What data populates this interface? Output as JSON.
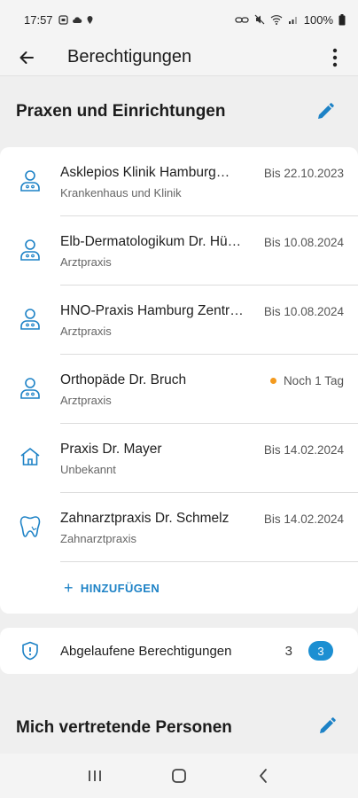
{
  "status_bar": {
    "time": "17:57",
    "battery": "100%"
  },
  "app_bar": {
    "title": "Berechtigungen"
  },
  "section_practices": {
    "title": "Praxen und Einrichtungen",
    "items": [
      {
        "name": "Asklepios Klinik Hamburg…",
        "type": "Krankenhaus und Klinik",
        "meta": "Bis 22.10.2023",
        "icon": "doctor-icon",
        "warning": false
      },
      {
        "name": "Elb-Dermatologikum Dr. Hü…",
        "type": "Arztpraxis",
        "meta": "Bis 10.08.2024",
        "icon": "doctor-icon",
        "warning": false
      },
      {
        "name": "HNO-Praxis Hamburg Zentr…",
        "type": "Arztpraxis",
        "meta": "Bis 10.08.2024",
        "icon": "doctor-icon",
        "warning": false
      },
      {
        "name": "Orthopäde Dr. Bruch",
        "type": "Arztpraxis",
        "meta": "Noch 1 Tag",
        "icon": "doctor-icon",
        "warning": true
      },
      {
        "name": "Praxis Dr. Mayer",
        "type": "Unbekannt",
        "meta": "Bis 14.02.2024",
        "icon": "house-icon",
        "warning": false
      },
      {
        "name": "Zahnarztpraxis Dr. Schmelz",
        "type": "Zahnarztpraxis",
        "meta": "Bis 14.02.2024",
        "icon": "tooth-icon",
        "warning": false
      }
    ],
    "add_label": "HINZUFÜGEN"
  },
  "expired": {
    "label": "Abgelaufene Berechtigungen",
    "count": "3",
    "badge": "3"
  },
  "section_representatives": {
    "title": "Mich vertretende Personen"
  },
  "colors": {
    "accent": "#1d82c6",
    "badge": "#1c8fd2",
    "warning": "#f39a1e"
  }
}
